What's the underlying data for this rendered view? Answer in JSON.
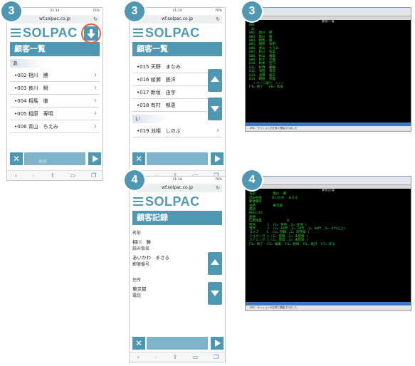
{
  "phone": {
    "time": "21:14",
    "battery": "76%",
    "url": "wf.solpac.co.jp",
    "logo": "SOLPAC"
  },
  "panel1": {
    "step": "3",
    "title": "顧客一覧",
    "section_a": "あ",
    "rows": [
      "•002  相川　勝",
      "•003  哀川　瞬",
      "•004  相馬　徹",
      "•005  相原　寿明",
      "•006  青山　ちえみ"
    ],
    "search_placeholder": "検索"
  },
  "panel2": {
    "step": "3",
    "title": "顧客一覧",
    "rows": [
      "•015  天野　まなみ",
      "•016  綾瀬　鉄洋",
      "•017  新垣　由宇",
      "•018  有村　郁恵"
    ],
    "section_i": "い",
    "rows2": [
      "•019  池相　しのぶ"
    ]
  },
  "panel3": {
    "step": "3",
    "header": "顧客一覧",
    "lines": [
      "",
      "001",
      "",
      " あ",
      "002. 相川  勝",
      "003. 哀川  瞬",
      "004. 相馬  徹",
      "005. 相原  寿明",
      "006. 青山  ちえみ",
      "007. 秋川  有美",
      "008. 秋山  雅章",
      "009. 秋元  大蔵",
      "010. 秋本  佳乃",
      "011. 秋野  慶輔",
      "012. 浅田  香苗",
      "013. 浅野  朋子",
      "014. 朝倉  英雄",
      "",
      "  ・ページ送り  ←・→",
      "",
      "F3= 終了   F6= 作成"
    ],
    "status": "ZRC - サッションが正常に開始されました"
  },
  "panel4": {
    "step": "4",
    "title": "顧客記録",
    "fields": [
      {
        "label": "名前",
        "value": "相川　勝"
      },
      {
        "label": "読み仮名",
        "value": "あいかわ　まさる"
      },
      {
        "label": "郵便番号",
        "value": ""
      },
      {
        "label": "住所",
        "value": "東京都"
      },
      {
        "label": "電話",
        "value": ""
      }
    ]
  },
  "panel5": {
    "step": "4",
    "header": "顧客記録",
    "lines": [
      "",
      "名前         相川  勝",
      "読み仮名     あいかわ  まさる",
      "",
      "郵便番号",
      "住所         東京都",
      "",
      "電話",
      "Website",
      "連絡",
      "",
      "信用限度             0",
      "",
      "性別      1  (1= 男性 ,2= 女性 )",
      "世代      1  (1= 10代 ,2= 20代 ,3= 30代 ,4= それ以上)",
      "ゴルフ    1  (1= 登録 ,2= 未登録 )",
      "ジョギング 1 (1= 登録 ,2= 未登録 )",
      "スイミング 1 (1= 登録 ,2= 未登録 )",
      "",
      "",
      "F3= 終了  F2= 編集  F4= 削除  F5= 統計  F7= 戻る"
    ],
    "status": "ZRC - サッションが正常に開始されました"
  }
}
